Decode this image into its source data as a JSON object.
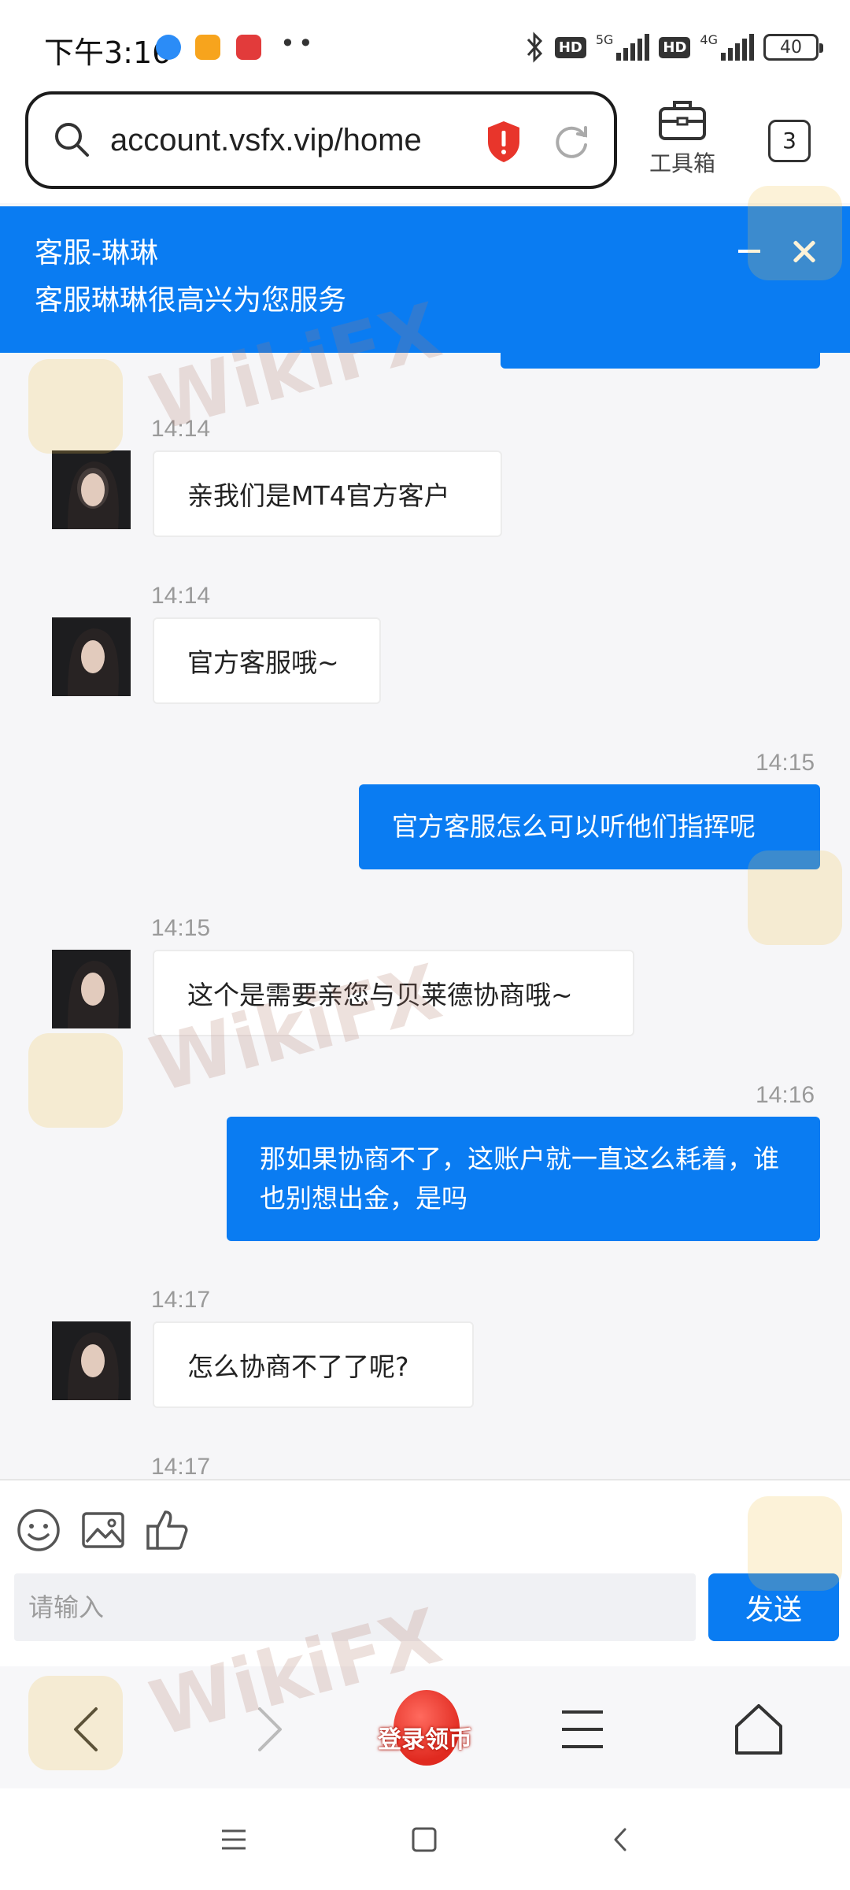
{
  "status_bar": {
    "time": "下午3:16",
    "dots": "••",
    "hd": "HD",
    "net_5g": "5G",
    "net_4g": "4G",
    "battery": "40"
  },
  "browser": {
    "url": "account.vsfx.vip/home",
    "toolbox_label": "工具箱",
    "tab_count": "3"
  },
  "chat_header": {
    "agent_name": "客服-琳琳",
    "greeting": "客服琳琳很高兴为您服务"
  },
  "messages": [
    {
      "direction": "in",
      "time": "14:14",
      "text": "亲我们是MT4官方客户"
    },
    {
      "direction": "in",
      "time": "14:14",
      "text": "官方客服哦~"
    },
    {
      "direction": "out",
      "time": "14:15",
      "text": "官方客服怎么可以听他们指挥呢"
    },
    {
      "direction": "in",
      "time": "14:15",
      "text": "这个是需要亲您与贝莱德协商哦~"
    },
    {
      "direction": "out",
      "time": "14:16",
      "text": "那如果协商不了，这账户就一直这么耗着，谁也别想出金，是吗"
    },
    {
      "direction": "in",
      "time": "14:17",
      "text": "怎么协商不了了呢?"
    },
    {
      "direction": "in",
      "time": "14:17",
      "text": ""
    }
  ],
  "composer": {
    "placeholder": "请输入",
    "send_label": "发送"
  },
  "bottom_nav": {
    "promo_label": "登录领币"
  },
  "watermark": "WikiFX",
  "colors": {
    "accent": "#0a7cf2",
    "header_bg": "#0a7cf2",
    "chat_bg": "#f6f6f8"
  }
}
